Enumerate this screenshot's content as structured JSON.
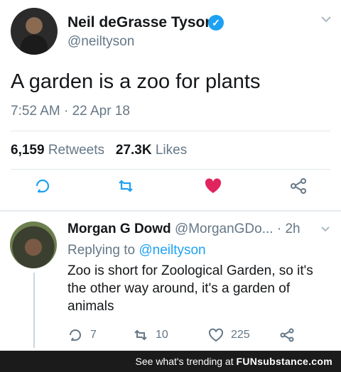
{
  "main_tweet": {
    "author_name": "Neil deGrasse Tyson",
    "handle": "@neiltyson",
    "text": "A garden is a zoo for plants",
    "timestamp": "7:52 AM · 22 Apr 18",
    "retweets_count": "6,159",
    "retweets_label": "Retweets",
    "likes_count": "27.3K",
    "likes_label": "Likes",
    "verified_glyph": "✓",
    "icons": [
      "reply-icon",
      "retweet-icon",
      "like-icon-filled",
      "share-icon",
      "chevron-down-icon"
    ],
    "colors": {
      "like": "#e0245e",
      "muted": "#657786",
      "link": "#1da1f2"
    }
  },
  "reply_tweet": {
    "author_name": "Morgan G Dowd",
    "handle": "@MorganGDo...",
    "time": "· 2h",
    "replying_prefix": "Replying to",
    "replying_handle": "@neiltyson",
    "text": "Zoo is short for Zoological Garden, so it's the other way around, it's a garden of animals",
    "reply_count": "7",
    "retweet_count": "10",
    "like_count": "225",
    "icons": [
      "reply-icon",
      "retweet-icon",
      "like-icon",
      "share-icon",
      "chevron-down-icon"
    ]
  },
  "footer": {
    "prefix": "See what's trending at",
    "brand": "FUNsubstance.com"
  }
}
